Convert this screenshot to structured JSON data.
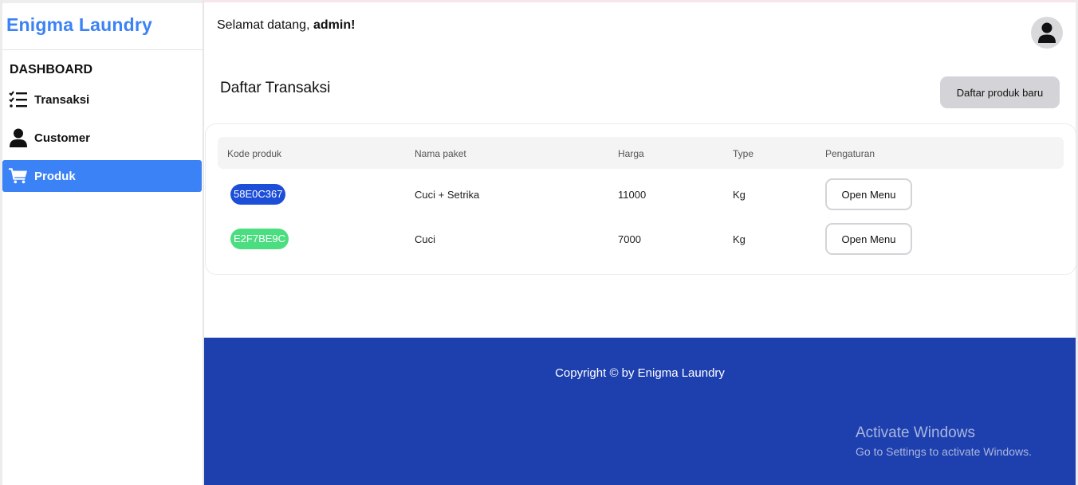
{
  "brand": {
    "name": "Enigma Laundry",
    "color": "#3b82f6"
  },
  "sidebar": {
    "section_title": "DASHBOARD",
    "items": [
      {
        "label": "Transaksi",
        "icon": "list-check-icon",
        "active": false
      },
      {
        "label": "Customer",
        "icon": "user-icon",
        "active": false
      },
      {
        "label": "Produk",
        "icon": "cart-icon",
        "active": true
      }
    ]
  },
  "header": {
    "greeting": "Selamat datang, ",
    "username": "admin!",
    "avatar_icon": "user-avatar-icon"
  },
  "main": {
    "title": "Daftar Transaksi",
    "new_button": "Daftar produk baru"
  },
  "table": {
    "headers": [
      "Kode produk",
      "Nama paket",
      "Harga",
      "Type",
      "Pengaturan"
    ],
    "rows": [
      {
        "code": "58E0C367",
        "code_color": "#1d4ed8",
        "name": "Cuci + Setrika",
        "price": "11000",
        "type": "Kg",
        "action": "Open Menu"
      },
      {
        "code": "E2F7BE9C",
        "code_color": "#4ade80",
        "name": "Cuci",
        "price": "7000",
        "type": "Kg",
        "action": "Open Menu"
      }
    ]
  },
  "footer": {
    "copyright": "Copyright © by Enigma Laundry",
    "background": "#1e40af"
  },
  "watermark": {
    "title": "Activate Windows",
    "subtitle": "Go to Settings to activate Windows."
  }
}
